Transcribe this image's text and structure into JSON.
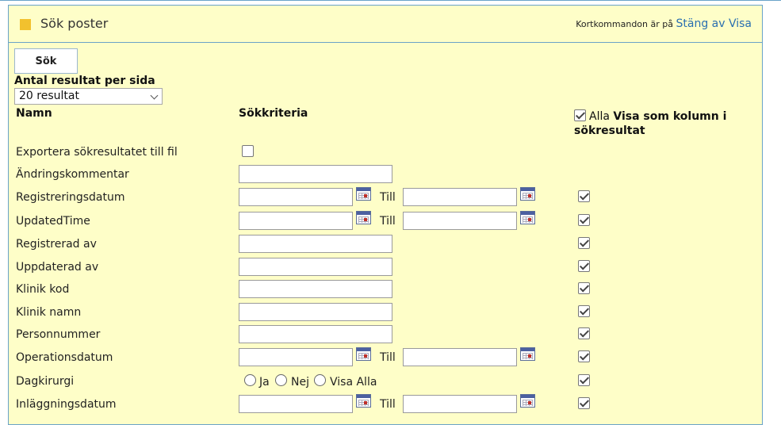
{
  "panel": {
    "title": "Sök poster",
    "shortcut_prefix": "Kortkommandon är på",
    "shortcut_link": "Stäng av Visa"
  },
  "search": {
    "button_label": "Sök",
    "results_label": "Antal resultat per sida",
    "results_selected": "20 resultat"
  },
  "columns": {
    "name": "Namn",
    "criteria": "Sökkriteria",
    "all_label": "Alla",
    "show_as_column": "Visa som kolumn i sökresultat"
  },
  "till_label": "Till",
  "rows": [
    {
      "label": "Exportera sökresultatet till fil",
      "type": "checkbox"
    },
    {
      "label": "Ändringskommentar",
      "type": "text"
    },
    {
      "label": "Registreringsdatum",
      "type": "daterange",
      "show_column": true
    },
    {
      "label": "UpdatedTime",
      "type": "daterange",
      "show_column": true
    },
    {
      "label": "Registrerad av",
      "type": "text",
      "show_column": true
    },
    {
      "label": "Uppdaterad av",
      "type": "text",
      "show_column": true
    },
    {
      "label": "Klinik kod",
      "type": "text",
      "show_column": true
    },
    {
      "label": "Klinik namn",
      "type": "text",
      "show_column": true
    },
    {
      "label": "Personnummer",
      "type": "text",
      "show_column": true
    },
    {
      "label": "Operationsdatum",
      "type": "daterange",
      "show_column": true
    },
    {
      "label": "Dagkirurgi",
      "type": "radio",
      "options": [
        "Ja",
        "Nej",
        "Visa Alla"
      ],
      "show_column": true
    },
    {
      "label": "Inläggningsdatum",
      "type": "daterange",
      "show_column": true
    }
  ],
  "colors": {
    "panel_bg": "#fefec8",
    "border": "#6aa3c8",
    "title_square": "#f2c12e",
    "link": "#2a6fb0"
  }
}
